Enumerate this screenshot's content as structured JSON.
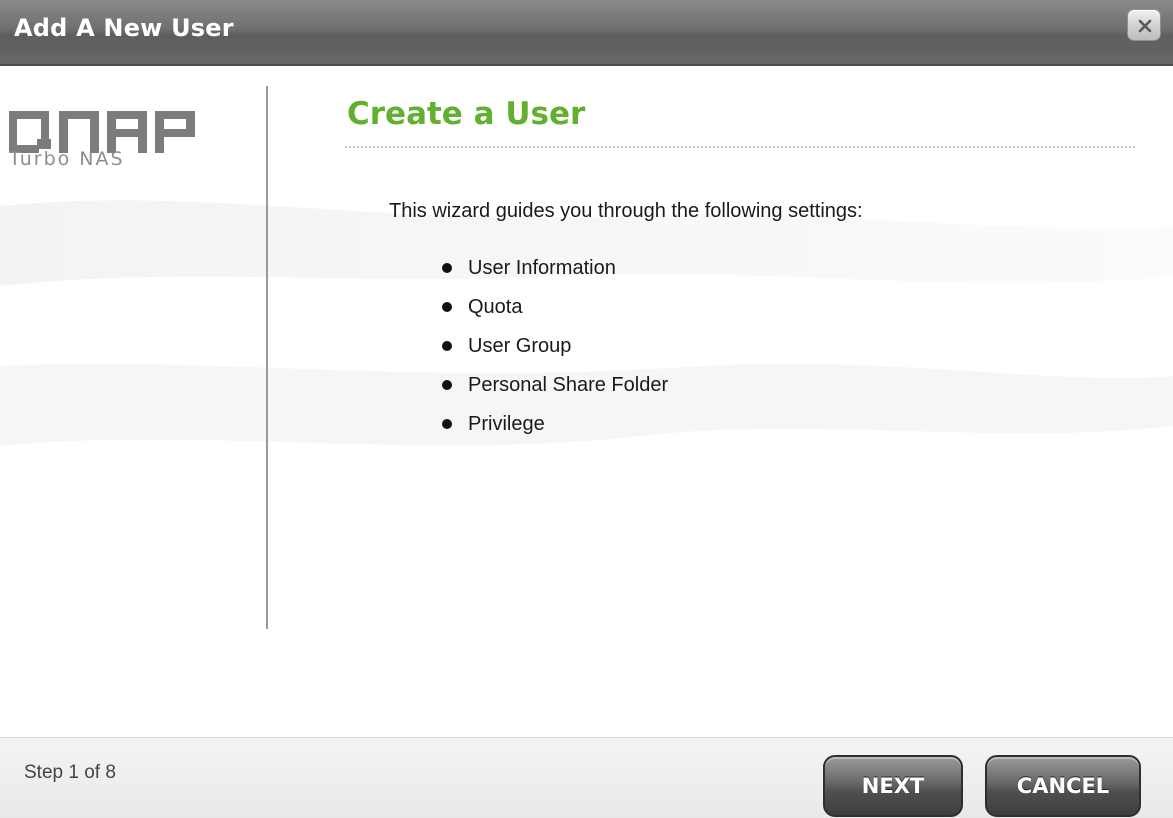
{
  "window": {
    "title": "Add A New User",
    "close_icon": "close-icon"
  },
  "sidebar": {
    "logo_text": "QNAP",
    "logo_subtitle": "Turbo NAS"
  },
  "main": {
    "heading": "Create a User",
    "intro": "This wizard guides you through the following settings:",
    "settings": [
      "User Information",
      "Quota",
      "User Group",
      "Personal Share Folder",
      "Privilege"
    ]
  },
  "footer": {
    "step_text": "Step 1 of 8",
    "next_label": "NEXT",
    "cancel_label": "CANCEL"
  },
  "colors": {
    "heading_green": "#62b030",
    "titlebar_gray": "#6f6f6f",
    "button_dark": "#4f4f4f"
  }
}
